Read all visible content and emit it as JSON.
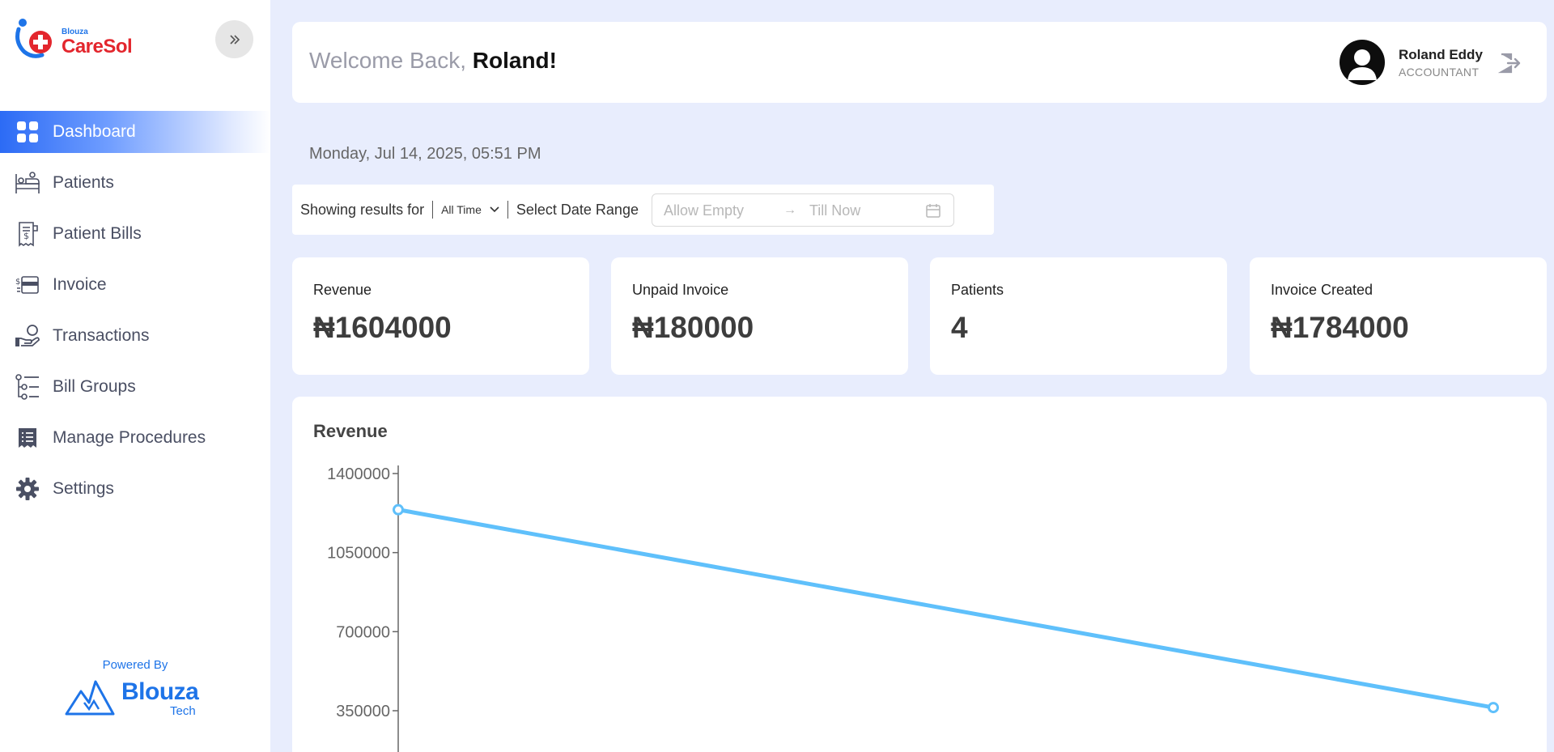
{
  "brand": {
    "small": "Blouza",
    "big": "CareSol"
  },
  "sidebar": {
    "items": [
      {
        "label": "Dashboard",
        "active": true
      },
      {
        "label": "Patients"
      },
      {
        "label": "Patient Bills"
      },
      {
        "label": "Invoice"
      },
      {
        "label": "Transactions"
      },
      {
        "label": "Bill Groups"
      },
      {
        "label": "Manage Procedures"
      },
      {
        "label": "Settings"
      }
    ],
    "powered_by": "Powered By",
    "footer_brand": {
      "name": "Blouza",
      "sub": "Tech"
    }
  },
  "header": {
    "welcome_prefix": "Welcome Back,",
    "welcome_name": "Roland!",
    "user_name": "Roland Eddy",
    "user_role": "ACCOUNTANT"
  },
  "date_line": "Monday, Jul 14, 2025, 05:51 PM",
  "filter": {
    "showing_label": "Showing results for",
    "period": "All Time",
    "range_label": "Select Date Range",
    "start_placeholder": "Allow Empty",
    "end_placeholder": "Till Now"
  },
  "stats": [
    {
      "title": "Revenue",
      "value": "₦1604000"
    },
    {
      "title": "Unpaid Invoice",
      "value": "₦180000"
    },
    {
      "title": "Patients",
      "value": "4"
    },
    {
      "title": "Invoice Created",
      "value": "₦1784000"
    }
  ],
  "colors": {
    "accent": "#2c6bf5",
    "line": "#5fc0fb",
    "brand_red": "#e3262d",
    "brand_blue": "#1e74e8"
  },
  "chart_data": {
    "type": "line",
    "title": "Revenue",
    "y_ticks": [
      1400000,
      1050000,
      700000,
      350000
    ],
    "ylim": [
      0,
      1400000
    ],
    "series": [
      {
        "values": [
          1240000,
          364000
        ]
      }
    ]
  }
}
